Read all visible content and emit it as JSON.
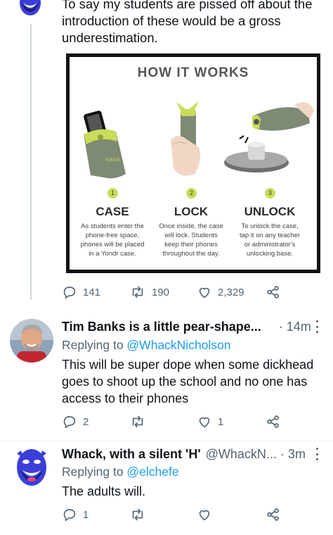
{
  "tweet1": {
    "text_line1": "To say my students are pissed off about the",
    "text_line2": "introduction of these would be a gross",
    "text_line3": "underestimation.",
    "card": {
      "title": "HOW IT WORKS",
      "steps": [
        {
          "num": "1",
          "head": "CASE",
          "desc1": "As students enter the",
          "desc2": "phone-free space,",
          "desc3": "phones will be placed",
          "desc4": "in a Yondr case."
        },
        {
          "num": "2",
          "head": "LOCK",
          "desc1": "Once inside, the case",
          "desc2": "will lock. Students",
          "desc3": "keep their phones",
          "desc4": "throughout the day."
        },
        {
          "num": "3",
          "head": "UNLOCK",
          "desc1": "To unlock the case,",
          "desc2": "tap it on any teacher",
          "desc3": "or administrator's",
          "desc4": "unlocking base."
        }
      ]
    },
    "actions": {
      "replies": "141",
      "retweets": "190",
      "likes": "2,329"
    }
  },
  "reply1": {
    "name": "Tim Banks is a little pear-shape...",
    "time": "· 14m",
    "replying_prefix": "Replying to ",
    "replying_to": "@WhackNicholson",
    "text_line1": "This will be super dope when some dickhead",
    "text_line2": "goes to shoot up the school and no one has",
    "text_line3": "access to their phones",
    "actions": {
      "replies": "2",
      "likes": "1"
    }
  },
  "reply2": {
    "name": "Whack, with a silent 'H'",
    "handle": "@WhackN...",
    "time": "· 3m",
    "replying_prefix": "Replying to ",
    "replying_to": "@elchefe",
    "text_line1": "The adults will.",
    "actions": {
      "replies": "1"
    }
  },
  "colors": {
    "link": "#1d9bf0",
    "muted": "#536471",
    "accent_green": "#c8dc5a"
  }
}
